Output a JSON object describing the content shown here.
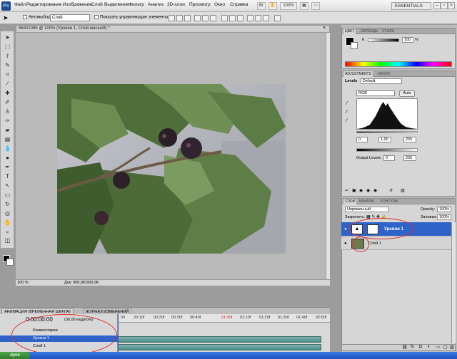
{
  "app": {
    "logo": "Ps",
    "menu": [
      "Файл",
      "Редактирование",
      "Изображение",
      "Слой",
      "Выделение",
      "Фильтр",
      "Анализ",
      "3D-слои",
      "Просмотр",
      "Окно",
      "Справка"
    ],
    "workspace": "ESSENTIALS",
    "zoom_control": "100%"
  },
  "options_bar": {
    "auto_select_label": "Автовыбор:",
    "auto_select_value": "Слой",
    "show_controls_label": "Показать управляющие элементы"
  },
  "document": {
    "title": "56301085 @ 100% (Уровни 1, Слой-маска/8) *",
    "zoom": "100 %",
    "doc_info": "Док: 900,0K/900,0K"
  },
  "timeline": {
    "tabs": [
      "АНИМАЦИЯ (ВРЕМЕННАЯ ШКАЛА)",
      "ЖУРНАЛ ИЗМЕНЕНИЙ"
    ],
    "time": "0:00:00:00",
    "fps": "(30,00 кадр/сек)",
    "ticks": [
      "00",
      "00:10f",
      "00:20f",
      "00:30f",
      "00:40f",
      "01:00f",
      "01:10f",
      "01:20f",
      "01:30f",
      "01:40f",
      "02:00f"
    ],
    "rows": [
      "Комментарии",
      "Уровни 1",
      "Слой 1"
    ]
  },
  "color_panel": {
    "tabs": [
      "ЦВЕТ",
      "ОБРАЗЦЫ",
      "СТИЛИ"
    ],
    "k_label": "K",
    "k_value": "100",
    "k_unit": "%"
  },
  "adjustments_panel": {
    "tabs": [
      "ADJUSTMENTS",
      "MASKS"
    ],
    "levels_label": "Levels",
    "preset_value": "Default",
    "channel": "RGB",
    "auto_label": "Auto",
    "input_black": "0",
    "input_gamma": "1,00",
    "input_white": "255",
    "output_label": "Output Levels:",
    "output_black": "0",
    "output_white": "255"
  },
  "layers_panel": {
    "tabs": [
      "СЛОИ",
      "КАНАЛЫ",
      "КОНТУРЫ"
    ],
    "blend_mode": "Нормальный",
    "opacity_label": "Opacity:",
    "opacity_value": "100%",
    "lock_label": "Закрепить:",
    "fill_label": "Заливка:",
    "fill_value": "100%",
    "layers": [
      "Уровни 1",
      "Слой 1"
    ]
  },
  "taskbar": {
    "start": "пуск"
  },
  "colors": {
    "selection": "#2f63c9",
    "annotation_red": "#e03030",
    "track": "#5f9a96"
  }
}
